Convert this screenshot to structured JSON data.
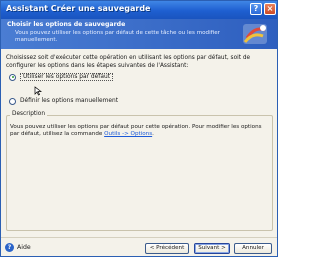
{
  "window": {
    "title": "Assistant Créer une sauvegarde",
    "help_button": "?",
    "close_button": "×"
  },
  "header": {
    "title": "Choisir les options de sauvegarde",
    "subtitle": "Vous pouvez utiliser les options par défaut de cette tâche ou les modifier manuellement."
  },
  "intro_text": "Choisissez soit d'exécuter cette opération en utilisant les options par défaut, soit de configurer les options dans les étapes suivantes de l'Assistant:",
  "options": {
    "default": {
      "label": "Utiliser les options par défaut",
      "selected": true
    },
    "manual": {
      "label": "Définir les options manuellement",
      "selected": false
    }
  },
  "description": {
    "legend": "Description",
    "text_before_link": "Vous pouvez utiliser les options par défaut pour cette opération. Pour modifier les options par défaut, utilisez la commande ",
    "link": "Outils -> Options",
    "text_after_link": "."
  },
  "footer": {
    "help_label": "Aide",
    "prev_button": "< Précédent",
    "next_button": "Suivant >",
    "cancel_button": "Annuler"
  },
  "colors": {
    "titlebar": "#1e5fd0",
    "header": "#3a6cc9",
    "link": "#1b5ad8"
  }
}
